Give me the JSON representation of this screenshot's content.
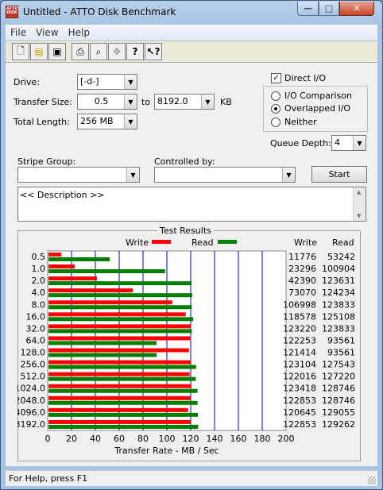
{
  "window": {
    "title": "Untitled - ATTO Disk Benchmark",
    "icon_text": "ATTO DISK"
  },
  "menu": [
    "File",
    "View",
    "Help"
  ],
  "toolbar": [
    "new-icon",
    "open-icon",
    "save-icon",
    "print-icon",
    "print-preview-icon",
    "move-icon",
    "help-icon",
    "context-help-icon"
  ],
  "form": {
    "drive_label": "Drive:",
    "drive_value": "[-d-]",
    "transfer_label": "Transfer Size:",
    "transfer_from": "0.5",
    "to_label": "to",
    "transfer_to": "8192.0",
    "kb_label": "KB",
    "length_label": "Total Length:",
    "length_value": "256 MB",
    "direct_io": "Direct I/O",
    "io_comparison": "I/O Comparison",
    "overlapped_io": "Overlapped I/O",
    "neither": "Neither",
    "queue_label": "Queue Depth:",
    "queue_value": "4",
    "stripe_label": "Stripe Group:",
    "controlled_label": "Controlled by:",
    "start": "Start",
    "description": "<< Description >>"
  },
  "results": {
    "title": "Test Results",
    "write_legend": "Write",
    "read_legend": "Read",
    "col_write": "Write",
    "col_read": "Read",
    "xlabel": "Transfer Rate - MB / Sec"
  },
  "colors": {
    "write": "#ff0000",
    "read": "#008000",
    "grid": "#0000c0"
  },
  "chart_data": {
    "type": "bar",
    "categories": [
      "0.5",
      "1.0",
      "2.0",
      "4.0",
      "8.0",
      "16.0",
      "32.0",
      "64.0",
      "128.0",
      "256.0",
      "512.0",
      "1024.0",
      "2048.0",
      "4096.0",
      "8192.0"
    ],
    "series": [
      {
        "name": "Write",
        "values": [
          11776,
          23296,
          42390,
          73070,
          106998,
          118578,
          123220,
          122253,
          121414,
          123104,
          122016,
          123418,
          122853,
          120645,
          122853
        ]
      },
      {
        "name": "Read",
        "values": [
          53242,
          100904,
          123631,
          124234,
          123833,
          125108,
          123833,
          93561,
          93561,
          127543,
          127220,
          128746,
          128746,
          129055,
          129262
        ]
      }
    ],
    "xlabel": "Transfer Rate - MB / Sec",
    "xticks": [
      "0",
      "20",
      "40",
      "60",
      "80",
      "100",
      "120",
      "140",
      "160",
      "180",
      "200"
    ],
    "xlim": [
      0,
      200
    ],
    "grid": true
  },
  "status": "For Help, press F1"
}
